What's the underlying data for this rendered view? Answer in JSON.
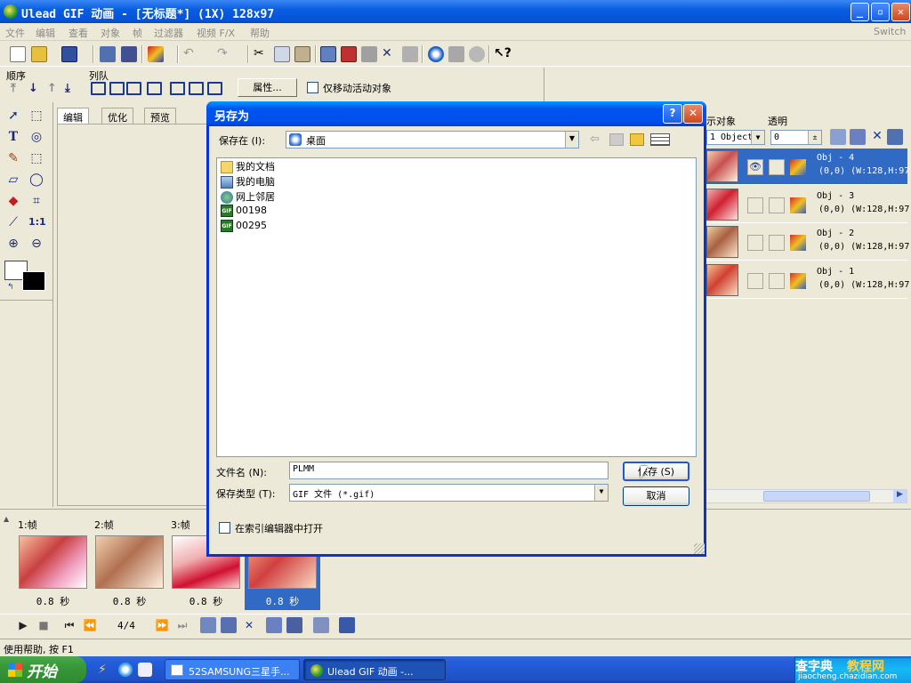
{
  "app": {
    "title": "Ulead GIF 动画 - [无标题*] (1X) 128x97",
    "min_glyph": "_",
    "max_glyph": "▫",
    "close_glyph": "✕"
  },
  "menu": {
    "items": [
      "文件",
      "编辑",
      "查看",
      "对象",
      "帧",
      "过滤器",
      "视频 F/X",
      "帮助"
    ],
    "switch": "Switch"
  },
  "toolbar2": {
    "order_label": "顺序",
    "align_label": "列队",
    "properties_button": "属性...",
    "move_active_only": "仅移动活动对象"
  },
  "workspace": {
    "tabs": [
      "编辑",
      "优化",
      "预览"
    ]
  },
  "objects_panel": {
    "header_objects": "示对象",
    "header_transparency": "透明",
    "filter_value": "1 Object:",
    "transparency_value": "0",
    "rows": [
      {
        "name": "Obj - 4",
        "info": "(0,0) (W:128,H:97)",
        "selected": true
      },
      {
        "name": "Obj - 3",
        "info": "(0,0) (W:128,H:97)",
        "selected": false
      },
      {
        "name": "Obj - 2",
        "info": "(0,0) (W:128,H:97)",
        "selected": false
      },
      {
        "name": "Obj - 1",
        "info": "(0,0) (W:128,H:97)",
        "selected": false
      }
    ]
  },
  "frames": [
    {
      "label": "1:帧",
      "duration": "0.8 秒",
      "selected": false
    },
    {
      "label": "2:帧",
      "duration": "0.8 秒",
      "selected": false
    },
    {
      "label": "3:帧",
      "duration": "0.8 秒",
      "selected": false
    },
    {
      "label": "",
      "duration": "0.8 秒",
      "selected": true
    }
  ],
  "playbar": {
    "frame_counter": "4/4"
  },
  "status": {
    "text": "使用帮助, 按 F1"
  },
  "taskbar": {
    "start": "开始",
    "tasks": [
      "52SAMSUNG三星手...",
      "Ulead GIF 动画 -..."
    ],
    "watermark_site": "查字典",
    "watermark_section": "教程网",
    "watermark_url": "jiaocheng.chazidian.com"
  },
  "dialog": {
    "title": "另存为",
    "help_glyph": "?",
    "close_glyph": "✕",
    "save_in_label": "保存在 (I):",
    "save_in_value": "桌面",
    "files": [
      {
        "name": "我的文档",
        "icon": "folder-icon"
      },
      {
        "name": "我的电脑",
        "icon": "computer-icon"
      },
      {
        "name": "网上邻居",
        "icon": "network-icon"
      },
      {
        "name": "00198",
        "icon": "gif-file-icon"
      },
      {
        "name": "00295",
        "icon": "gif-file-icon"
      }
    ],
    "filename_label": "文件名 (N):",
    "filename_value": "PLMM",
    "filetype_label": "保存类型 (T):",
    "filetype_value": "GIF 文件 (*.gif)",
    "save_button": "保存 (S)",
    "cancel_button": "取消",
    "open_in_index_editor": "在索引编辑器中打开",
    "icon_gif_text": "GIF"
  },
  "colors": {
    "selection": "#316ac5",
    "title_blue": "#0053ee",
    "face": "#ece9d8"
  }
}
